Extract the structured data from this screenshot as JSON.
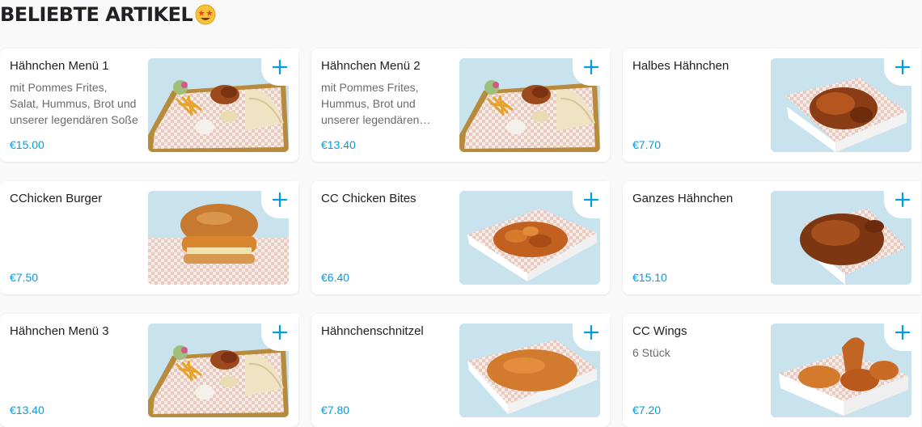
{
  "section": {
    "title": "BELIEBTE ARTIKEL",
    "emoji_icon": "star-struck-emoji-icon"
  },
  "colors": {
    "accent": "#009de0",
    "image_bg": "#c8e2ee"
  },
  "items": [
    {
      "name": "Hähnchen Menü 1",
      "description": "mit Pommes Frites, Salat, Hummus, Brot und unserer legendären Soße",
      "price": "€15.00",
      "image": "menu-tray"
    },
    {
      "name": "Hähnchen Menü 2",
      "description": "mit Pommes Frites, Hummus, Brot und unserer legendären Chicken Soße",
      "price": "€13.40",
      "image": "menu-tray"
    },
    {
      "name": "Halbes Hähnchen",
      "description": "",
      "price": "€7.70",
      "image": "half-chicken"
    },
    {
      "name": "CChicken Burger",
      "description": "",
      "price": "€7.50",
      "image": "burger"
    },
    {
      "name": "CC Chicken Bites",
      "description": "",
      "price": "€6.40",
      "image": "bites"
    },
    {
      "name": "Ganzes Hähnchen",
      "description": "",
      "price": "€15.10",
      "image": "whole-chicken"
    },
    {
      "name": "Hähnchen Menü 3",
      "description": "",
      "price": "€13.40",
      "image": "menu-tray"
    },
    {
      "name": "Hähnchenschnitzel",
      "description": "",
      "price": "€7.80",
      "image": "schnitzel"
    },
    {
      "name": "CC Wings",
      "description": "6 Stück",
      "price": "€7.20",
      "image": "wings"
    }
  ]
}
